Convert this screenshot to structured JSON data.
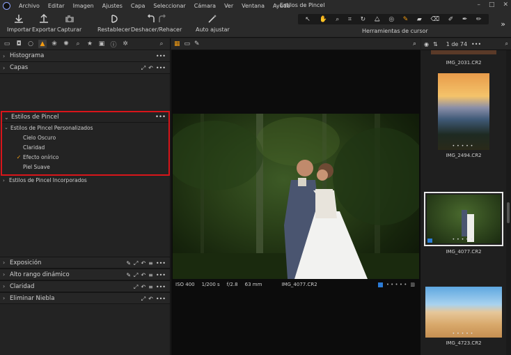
{
  "menubar": {
    "items": [
      "Archivo",
      "Editar",
      "Imagen",
      "Ajustes",
      "Capa",
      "Seleccionar",
      "Cámara",
      "Ver",
      "Ventana",
      "Ayuda"
    ],
    "window_title": "Estilos de Pincel"
  },
  "toolbar": {
    "import_label": "Importar",
    "export_label": "Exportar",
    "capture_label": "Capturar",
    "reset_label": "Restablecer",
    "undo_redo_label": "Deshacer/Rehacer",
    "auto_adjust_label": "Auto ajustar",
    "cursor_tools_label": "Herramientas de cursor"
  },
  "left_panel": {
    "sections_top": [
      {
        "label": "Histograma"
      },
      {
        "label": "Capas"
      }
    ],
    "brush_styles": {
      "title": "Estilos de Pincel",
      "custom_group": "Estilos de Pincel Personalizados",
      "items": [
        {
          "label": "Cielo Oscuro",
          "checked": false
        },
        {
          "label": "Claridad",
          "checked": false
        },
        {
          "label": "Efecto onírico",
          "checked": true
        },
        {
          "label": "Piel Suave",
          "checked": false
        }
      ],
      "builtin_group": "Estilos de Pincel Incorporados"
    },
    "sections_bottom": [
      {
        "label": "Exposición"
      },
      {
        "label": "Alto rango dinámico"
      },
      {
        "label": "Claridad"
      },
      {
        "label": "Eliminar Niebla"
      }
    ]
  },
  "viewer": {
    "iso": "ISO 400",
    "shutter": "1/200 s",
    "aperture": "f/2.8",
    "focal": "63 mm",
    "filename": "IMG_4077.CR2"
  },
  "browser": {
    "counter": "1 de 74",
    "thumbnails": [
      {
        "name": "IMG_2031.CR2",
        "selected": false
      },
      {
        "name": "IMG_2494.CR2",
        "selected": false
      },
      {
        "name": "IMG_4077.CR2",
        "selected": true
      },
      {
        "name": "IMG_4723.CR2",
        "selected": false
      }
    ]
  },
  "colors": {
    "accent": "#f39c12",
    "highlight_border": "#d9151a",
    "selection_blue": "#2b7bd6"
  }
}
